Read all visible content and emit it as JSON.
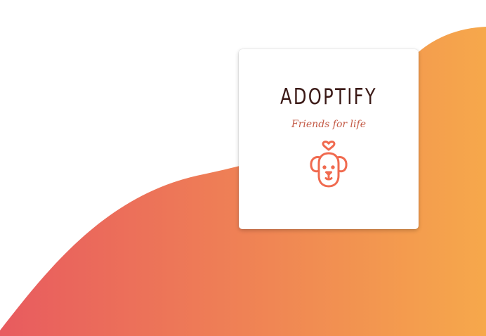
{
  "colors": {
    "gradient_start": "#e85b5f",
    "gradient_end": "#f6a84b",
    "brand_text": "#3b1a17",
    "tagline_text": "#c35a46",
    "icon_stroke": "#f06a4f"
  },
  "logo_card": {
    "brand_name": "ADOPTIFY",
    "tagline": "Friends for life",
    "icon": "dog-with-heart-icon"
  }
}
